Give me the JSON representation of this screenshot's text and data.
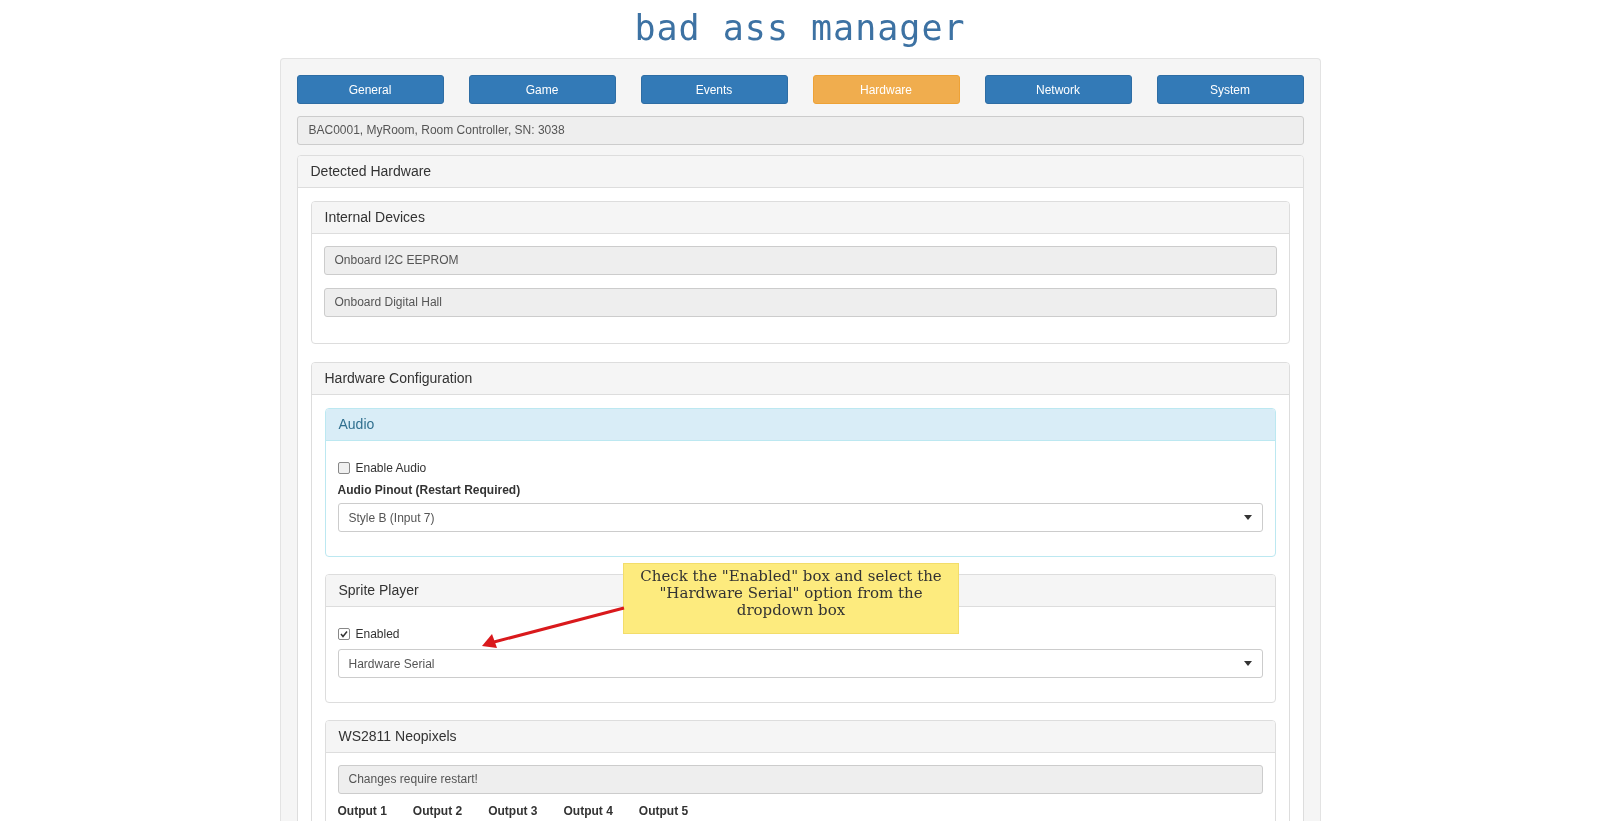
{
  "title": "bad ass manager",
  "tabs": [
    {
      "label": "General",
      "selected": false
    },
    {
      "label": "Game",
      "selected": false
    },
    {
      "label": "Events",
      "selected": false
    },
    {
      "label": "Hardware",
      "selected": true
    },
    {
      "label": "Network",
      "selected": false
    },
    {
      "label": "System",
      "selected": false
    }
  ],
  "device_info": "BAC0001, MyRoom, Room Controller, SN: 3038",
  "detected_hardware": {
    "title": "Detected Hardware",
    "internal_devices": {
      "title": "Internal Devices",
      "items": [
        "Onboard I2C EEPROM",
        "Onboard Digital Hall"
      ]
    },
    "hardware_configuration": {
      "title": "Hardware Configuration",
      "audio": {
        "title": "Audio",
        "checkbox": {
          "label": "Enable Audio",
          "checked": false
        },
        "select_label": "Audio Pinout (Restart Required)",
        "select_value": "Style B (Input 7)"
      },
      "sprite_player": {
        "title": "Sprite Player",
        "checkbox": {
          "label": "Enabled",
          "checked": true
        },
        "select_value": "Hardware Serial"
      },
      "neopixels": {
        "title": "WS2811 Neopixels",
        "notice": "Changes require restart!",
        "outputs": [
          "Output 1",
          "Output 2",
          "Output 3",
          "Output 4",
          "Output 5"
        ]
      }
    }
  },
  "callout": {
    "text": "Check the \"Enabled\" box and select the \"Hardware Serial\" option from the dropdown box"
  }
}
